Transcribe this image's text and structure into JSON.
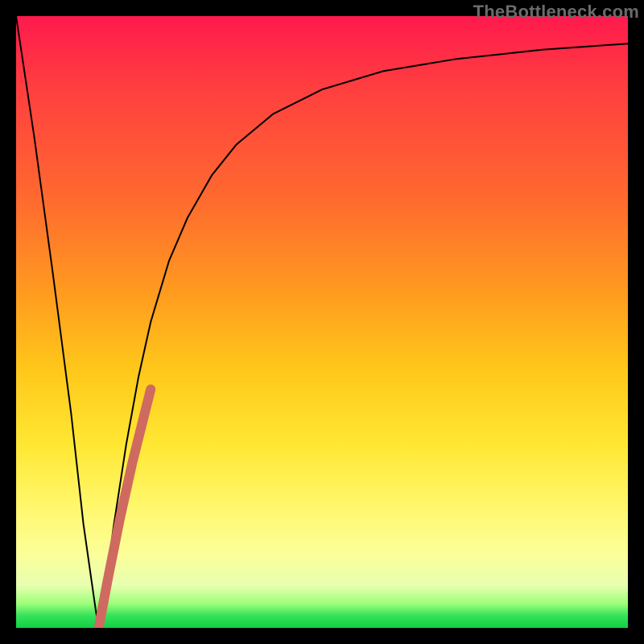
{
  "watermark": {
    "text": "TheBottleneck.com"
  },
  "chart_data": {
    "type": "line",
    "title": "",
    "xlabel": "",
    "ylabel": "",
    "xlim": [
      0,
      100
    ],
    "ylim": [
      0,
      100
    ],
    "background_gradient": {
      "direction": "vertical",
      "stops": [
        {
          "pos": 0,
          "color": "#ff1a4d",
          "meaning": "high bottleneck"
        },
        {
          "pos": 50,
          "color": "#ffb31a",
          "meaning": "moderate"
        },
        {
          "pos": 75,
          "color": "#fff23a",
          "meaning": "low"
        },
        {
          "pos": 100,
          "color": "#0ed145",
          "meaning": "no bottleneck"
        }
      ]
    },
    "series": [
      {
        "name": "bottleneck-curve",
        "color": "#000000",
        "stroke_width": 2,
        "x": [
          0,
          3,
          6,
          9,
          11,
          13,
          13.5,
          14,
          16,
          18,
          20,
          22,
          25,
          28,
          32,
          36,
          42,
          50,
          60,
          72,
          86,
          100
        ],
        "y": [
          100,
          80,
          58,
          35,
          17,
          3,
          0,
          3,
          17,
          30,
          41,
          50,
          60,
          67,
          74,
          79,
          84,
          88,
          91,
          93,
          94.5,
          95.5
        ]
      },
      {
        "name": "highlight-segment",
        "color": "#cf6a60",
        "stroke_width": 12,
        "linecap": "round",
        "x": [
          13.5,
          15,
          17,
          19,
          21,
          22
        ],
        "y": [
          0,
          8,
          18,
          27,
          35,
          39
        ]
      }
    ],
    "annotations": []
  }
}
